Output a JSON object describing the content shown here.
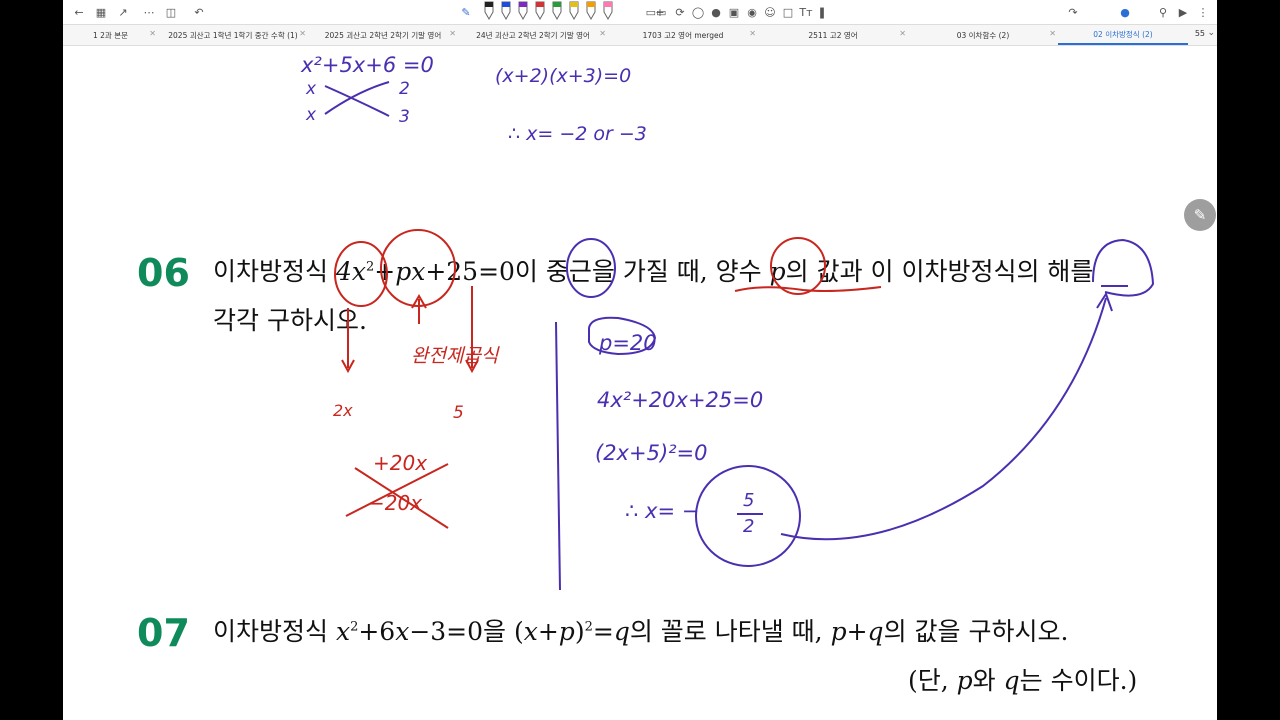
{
  "toolbar": {
    "left_icons": [
      "back-arrow-icon",
      "grid-icon",
      "export-icon",
      "apps-icon",
      "sidebar-icon",
      "undo-icon"
    ],
    "right_icons": [
      "undo-icon",
      "mic-icon",
      "search-icon",
      "share-icon",
      "more-icon"
    ],
    "text_tool_label": "Tт",
    "pen_colors": [
      "#222222",
      "#1e4fd6",
      "#7b2cbf",
      "#d33333",
      "#2a9a3a",
      "#e0c020",
      "#f2a000",
      "#ff7ab0"
    ]
  },
  "tabs": [
    {
      "label": "1 2과 본문"
    },
    {
      "label": "2025 괴산고 1학년 1학기 중간 수학 (1)"
    },
    {
      "label": "2025 괴산고 2학년 2학기 기말 영어"
    },
    {
      "label": "24년 괴산고 2학년 2학기 기말 영어"
    },
    {
      "label": "1703 고2 영어 merged"
    },
    {
      "label": "2511 고2 영어"
    },
    {
      "label": "03 이차함수 (2)"
    },
    {
      "label": "02 이차방정식 (2)"
    }
  ],
  "page_count": "55",
  "q06": {
    "number": "06",
    "line1": [
      "이차방정식 ",
      "4x",
      "2",
      "+",
      "px",
      "+25=0이 중근을 가질 때, 양수 ",
      "p",
      "의 값과 이 이차방정식의 해를"
    ],
    "line2": "각각 구하시오."
  },
  "q07": {
    "number": "07",
    "line1": [
      "이차방정식 ",
      "x",
      "2",
      "+6",
      "x",
      "−3=0을 (",
      "x",
      "+",
      "p",
      ")",
      "2",
      "=",
      "q",
      "의 꼴로 나타낼 때, ",
      "p",
      "+",
      "q",
      "의 값을 구하시오."
    ],
    "line2": [
      "(단, ",
      "p",
      "와 ",
      "q",
      "는 수이다.)"
    ]
  },
  "handwriting": {
    "top_eq": "x²+5x+6 =0",
    "top_factor_1_left": "x",
    "top_factor_1_right": "2",
    "top_factor_2_left": "x",
    "top_factor_2_right": "3",
    "top_factored": "(x+2)(x+3)=0",
    "top_solution": "∴ x= −2 or −3",
    "red_label": "완전제곱식",
    "red_2x": "2x",
    "red_5": "5",
    "red_plus20x": "+20x",
    "red_minus20x": "−20x",
    "blue_p": "p=20",
    "blue_eq1": "4x²+20x+25=0",
    "blue_eq2": "(2x+5)²=0",
    "blue_sol_prefix": "∴ x= −",
    "blue_sol_num": "5",
    "blue_sol_den": "2"
  },
  "colors": {
    "question_number": "#0f8a5a",
    "ink_red": "#c8261e",
    "ink_blue": "#4a2fb0",
    "active_tab": "#2a6fd6"
  }
}
